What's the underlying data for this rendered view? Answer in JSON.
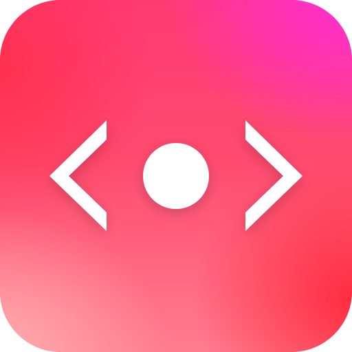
{
  "app_icon": {
    "name": "preview-app-icon",
    "colors": {
      "magenta": "#ff2fd2",
      "hot_pink": "#ff3a73",
      "red": "#ff2840",
      "light_pink": "#ffafaf",
      "glyph": "#ffffff"
    },
    "glyph": {
      "left": "chevron-left-icon",
      "center": "dot-icon",
      "right": "chevron-right-icon"
    }
  }
}
